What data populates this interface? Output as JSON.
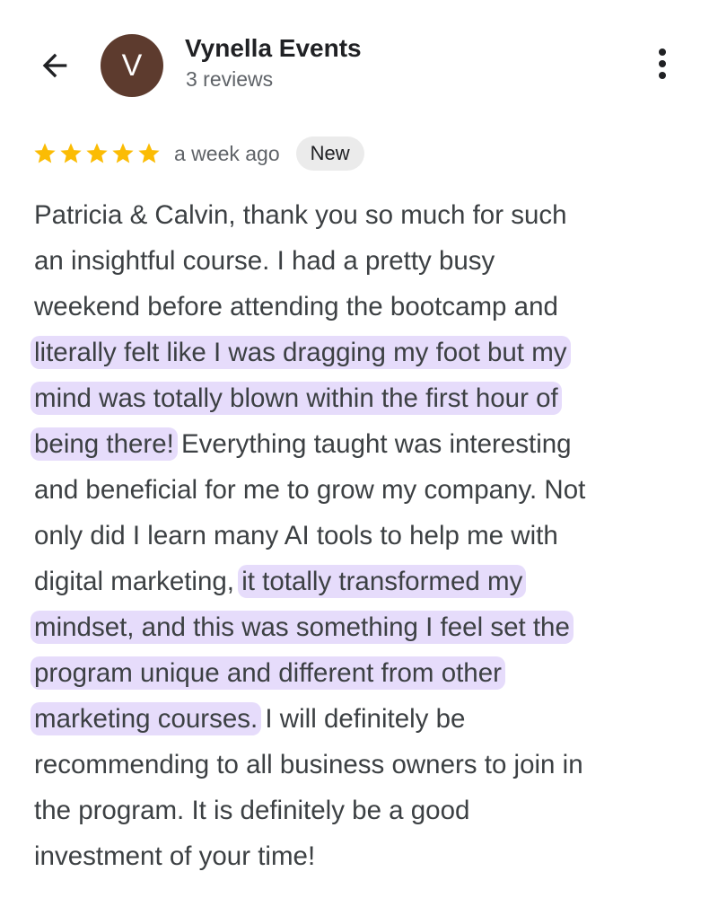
{
  "colors": {
    "avatar_bg": "#5d3b2e",
    "star": "#fbbc04",
    "highlight": "#e6dcfb",
    "badge_bg": "#ebebeb",
    "icon": "#202124"
  },
  "header": {
    "back_icon": "arrow-left-icon",
    "avatar_letter": "V",
    "reviewer_name": "Vynella Events",
    "review_count": "3 reviews",
    "more_icon": "more-vertical-icon"
  },
  "review": {
    "rating": 5,
    "max_rating": 5,
    "time": "a week ago",
    "badge": "New",
    "lines": [
      [
        {
          "text": "Patricia & Calvin, thank you so much for such",
          "hl": false
        }
      ],
      [
        {
          "text": "an insightful course. I had a pretty busy",
          "hl": false
        }
      ],
      [
        {
          "text": "weekend before attending the bootcamp and",
          "hl": false
        }
      ],
      [
        {
          "text": "literally felt like I was dragging my foot but my",
          "hl": true
        }
      ],
      [
        {
          "text": "mind was totally blown within the first hour of",
          "hl": true
        }
      ],
      [
        {
          "text": "being there!",
          "hl": true
        },
        {
          "text": " Everything taught was interesting",
          "hl": false
        }
      ],
      [
        {
          "text": "and beneficial for me to grow my company. Not",
          "hl": false
        }
      ],
      [
        {
          "text": "only did I learn many AI tools to help me with",
          "hl": false
        }
      ],
      [
        {
          "text": "digital marketing, ",
          "hl": false
        },
        {
          "text": "it totally transformed my",
          "hl": true
        }
      ],
      [
        {
          "text": "mindset, and this was something I feel set the",
          "hl": true
        }
      ],
      [
        {
          "text": "program unique and different from other",
          "hl": true
        }
      ],
      [
        {
          "text": "marketing courses.",
          "hl": true
        },
        {
          "text": " I will definitely be",
          "hl": false
        }
      ],
      [
        {
          "text": "recommending to all business owners to join in",
          "hl": false
        }
      ],
      [
        {
          "text": "the program. It is definitely be a good",
          "hl": false
        }
      ],
      [
        {
          "text": "investment of your time!",
          "hl": false
        }
      ]
    ]
  }
}
